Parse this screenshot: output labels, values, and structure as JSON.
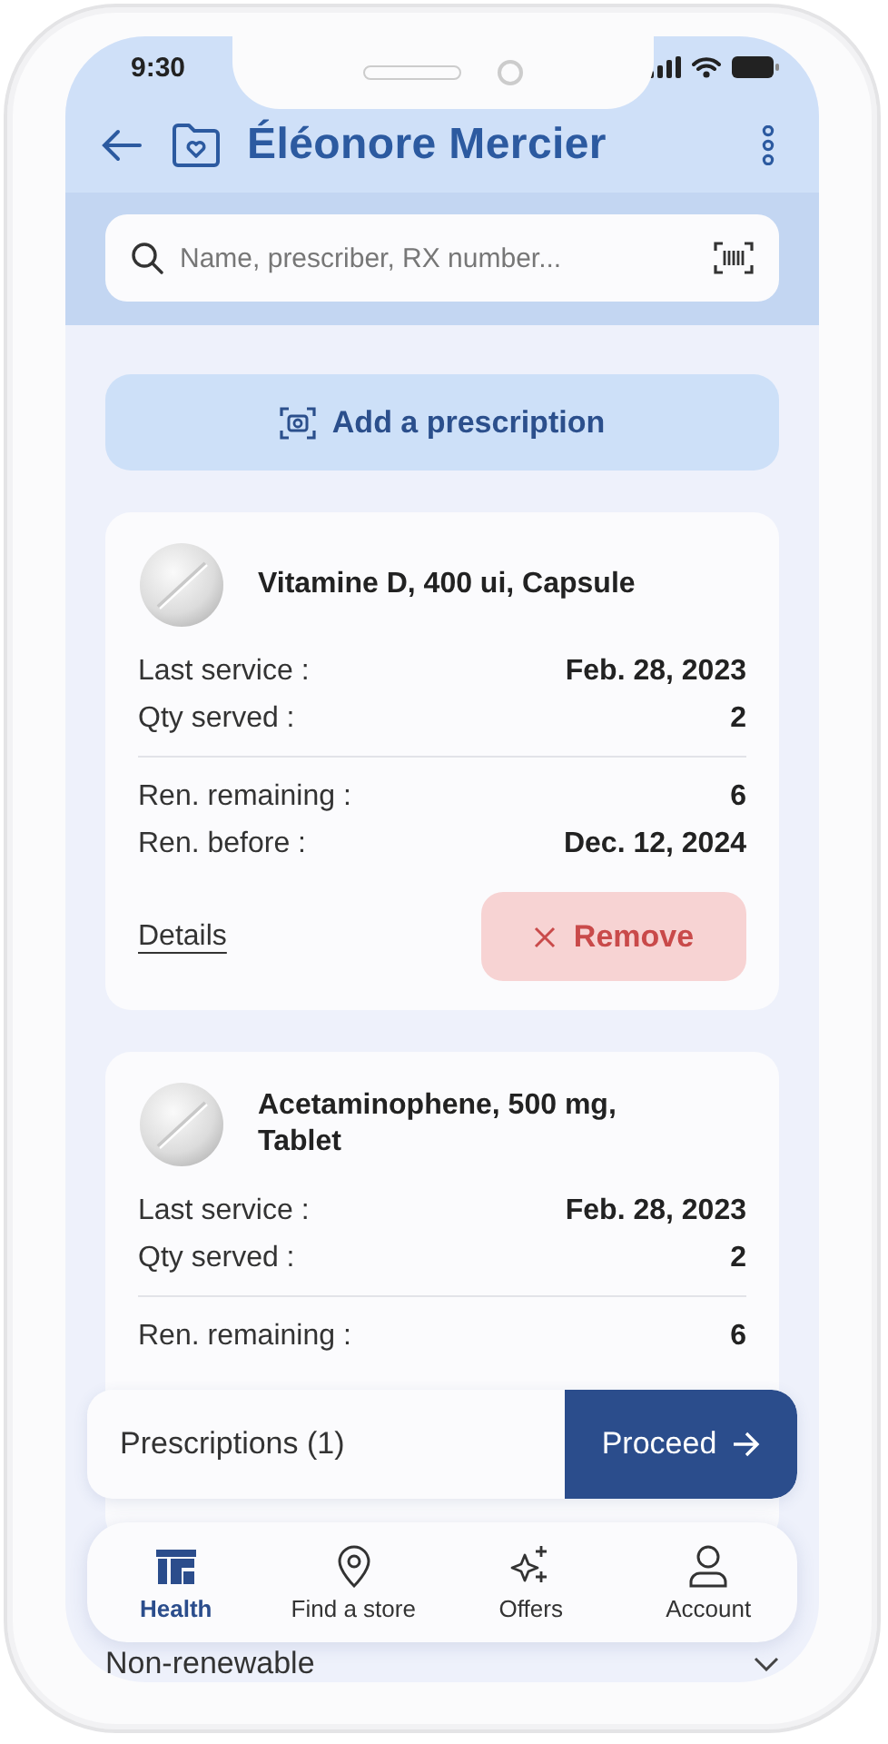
{
  "status_bar": {
    "time": "9:30"
  },
  "header": {
    "title": "Éléonore Mercier"
  },
  "search": {
    "placeholder": "Name, prescriber, RX number..."
  },
  "add_button": {
    "label": "Add a prescription"
  },
  "prescriptions": [
    {
      "name": "Vitamine D, 400 ui, Capsule",
      "sections": [
        [
          {
            "label": "Last service :",
            "value": "Feb. 28, 2023"
          },
          {
            "label": "Qty served :",
            "value": "2"
          }
        ],
        [
          {
            "label": "Ren. remaining :",
            "value": "6"
          },
          {
            "label": "Ren. before :",
            "value": "Dec. 12, 2024"
          }
        ]
      ],
      "details_link": "Details",
      "remove_button": "Remove"
    },
    {
      "name": "Acetaminophene, 500 mg, Tablet",
      "sections": [
        [
          {
            "label": "Last service :",
            "value": "Feb. 28, 2023"
          },
          {
            "label": "Qty served :",
            "value": "2"
          }
        ],
        [
          {
            "label": "Ren. remaining :",
            "value": "6"
          }
        ]
      ]
    }
  ],
  "section_header": {
    "label": "Non-renewable",
    "expanded": false
  },
  "cart_bar": {
    "label": "Prescriptions (1)",
    "button": "Proceed"
  },
  "bottom_nav": [
    {
      "label": "Health",
      "kind": "logo",
      "selected": true
    },
    {
      "label": "Find a store",
      "kind": "pin",
      "selected": false
    },
    {
      "label": "Offers",
      "kind": "sparkle",
      "selected": false
    },
    {
      "label": "Account",
      "kind": "person",
      "selected": false
    }
  ]
}
